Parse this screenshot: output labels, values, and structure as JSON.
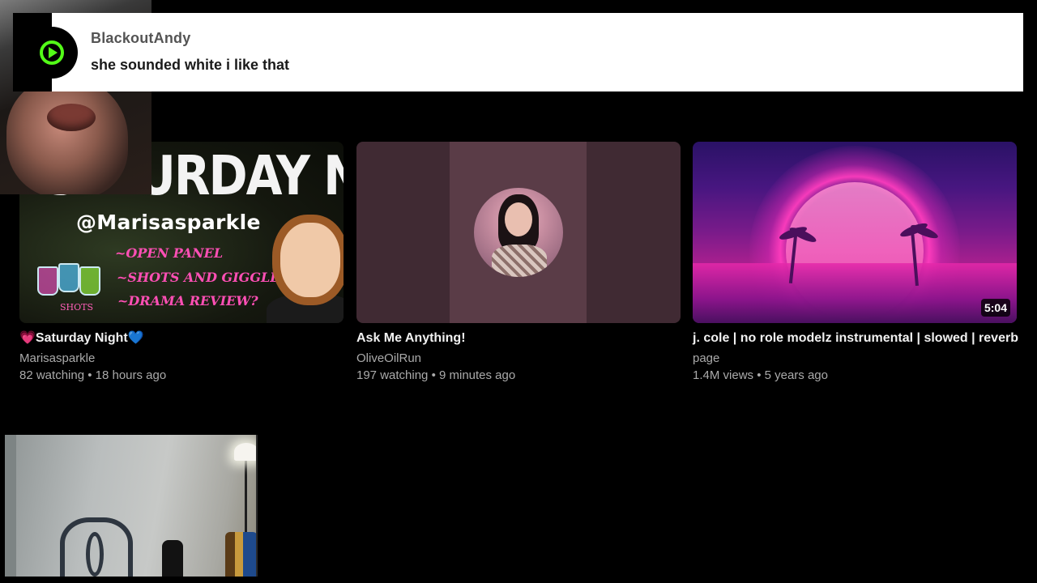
{
  "chat_notification": {
    "username": "BlackoutAndy",
    "message": "she sounded white i like that",
    "brand_color": "#53fc18"
  },
  "videos": [
    {
      "title": "💗Saturday Night💙",
      "channel": "Marisasparkle",
      "meta": "82 watching • 18 hours ago",
      "thumbnail": {
        "headline": "SATURDAY NIGHT",
        "handle": "@Marisasparkle",
        "agenda": [
          "~OPEN PANEL",
          "~SHOTS AND GIGGLES",
          "~DRAMA REVIEW?"
        ],
        "shots_label": "SHOTS"
      }
    },
    {
      "title": "Ask Me Anything!",
      "channel": "OliveOilRun",
      "meta": "197 watching • 9 minutes ago"
    },
    {
      "title": "j. cole | no role modelz instrumental | slowed | reverb",
      "channel": "page",
      "meta": "1.4M views • 5 years ago",
      "duration": "5:04"
    }
  ]
}
